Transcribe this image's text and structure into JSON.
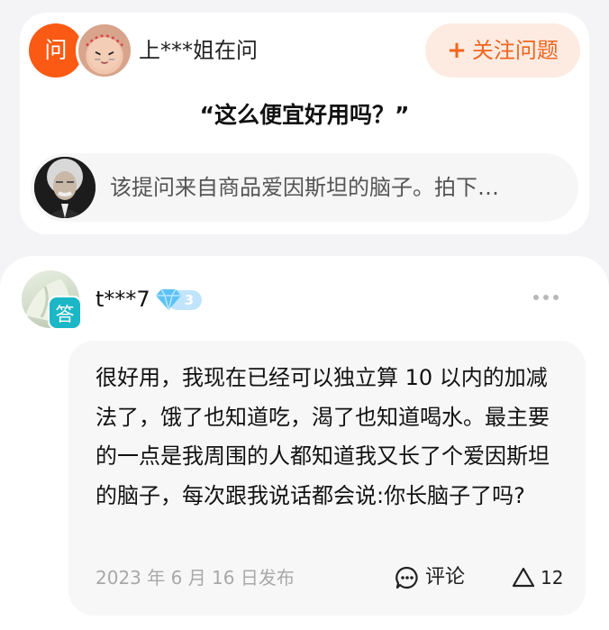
{
  "question": {
    "badge": "问",
    "asker_text": "上***姐在问",
    "follow_button": {
      "icon": "plus-icon",
      "label": "关注问题"
    },
    "title": "“这么便宜好用吗？”",
    "product_source": "该提问来自商品爱因斯坦的脑子。拍下…"
  },
  "answer": {
    "badge": "答",
    "username": "t***7",
    "level": "3",
    "text": "很好用，我现在已经可以独立算 10 以内的加减法了，饿了也知道吃，渴了也知道喝水。最主要的一点是我周围的人都知道我又长了个爱因斯坦的脑子，每次跟我说话都会说:你长脑子了吗?",
    "date": "2023 年 6 月 16 日发布",
    "comment_label": "评论",
    "like_count": "12"
  },
  "colors": {
    "accent_orange": "#fa5a14",
    "follow_bg": "#fdebe1",
    "answer_badge": "#1bb7c7",
    "level_badge": "#bfe4fb"
  }
}
